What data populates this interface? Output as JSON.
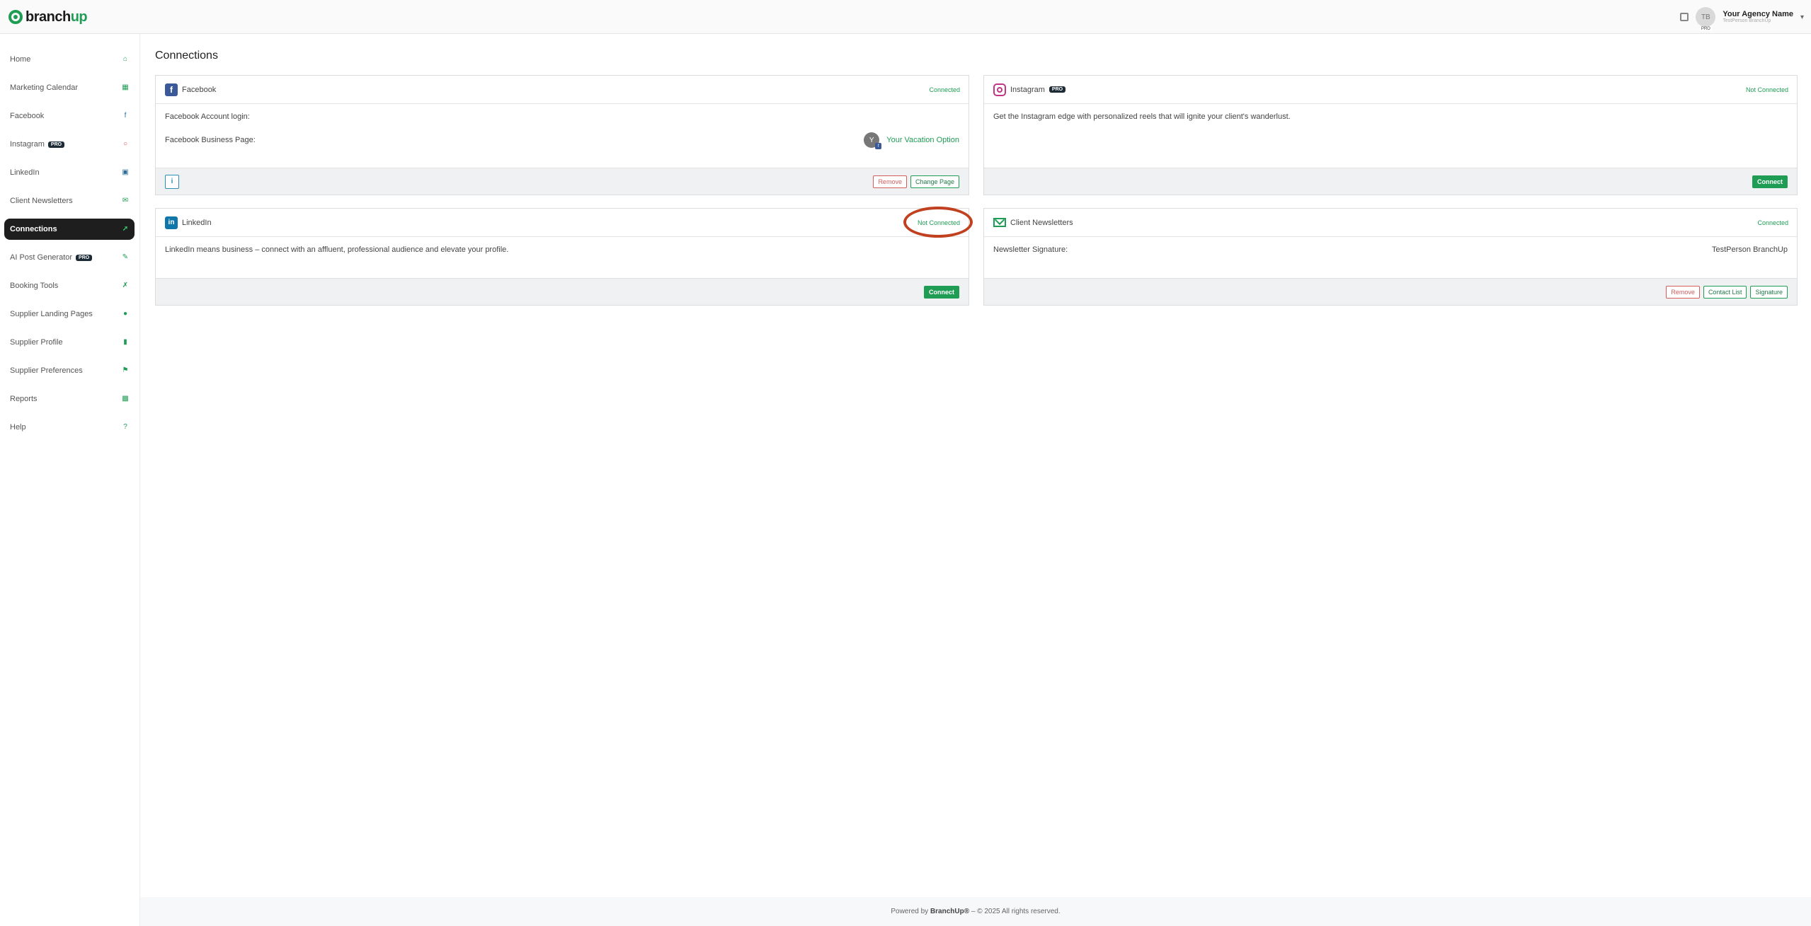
{
  "app": {
    "logo_part1": "branch",
    "logo_part2": "up"
  },
  "header": {
    "avatar_initials": "TB",
    "avatar_badge": "PRO",
    "agency_name": "Your Agency Name",
    "agency_sub": "TestPerson BranchUp"
  },
  "sidebar": {
    "items": [
      {
        "label": "Home",
        "icon": "home-icon"
      },
      {
        "label": "Marketing Calendar",
        "icon": "calendar-icon"
      },
      {
        "label": "Facebook",
        "icon": "facebook-icon"
      },
      {
        "label": "Instagram",
        "icon": "instagram-icon",
        "badge": "PRO"
      },
      {
        "label": "LinkedIn",
        "icon": "linkedin-icon"
      },
      {
        "label": "Client Newsletters",
        "icon": "envelope-icon"
      },
      {
        "label": "Connections",
        "icon": "plug-icon",
        "active": true
      },
      {
        "label": "AI Post Generator",
        "icon": "edit-icon",
        "badge": "PRO"
      },
      {
        "label": "Booking Tools",
        "icon": "wrench-icon"
      },
      {
        "label": "Supplier Landing Pages",
        "icon": "globe-icon"
      },
      {
        "label": "Supplier Profile",
        "icon": "book-icon"
      },
      {
        "label": "Supplier Preferences",
        "icon": "bookmark-icon"
      },
      {
        "label": "Reports",
        "icon": "chart-icon"
      },
      {
        "label": "Help",
        "icon": "question-icon"
      }
    ]
  },
  "main": {
    "title": "Connections",
    "facebook": {
      "title": "Facebook",
      "status": "Connected",
      "account_login_label": "Facebook Account login:",
      "business_page_label": "Facebook Business Page:",
      "page_avatar": "Y",
      "page_name": "Your Vacation Option",
      "remove_label": "Remove",
      "change_page_label": "Change Page"
    },
    "instagram": {
      "title": "Instagram",
      "badge": "PRO",
      "status": "Not Connected",
      "description": "Get the Instagram edge with personalized reels that will ignite your client's wanderlust.",
      "connect_label": "Connect"
    },
    "linkedin": {
      "title": "LinkedIn",
      "status": "Not Connected",
      "description": "LinkedIn means business – connect with an affluent, professional audience and elevate your profile.",
      "connect_label": "Connect"
    },
    "newsletters": {
      "title": "Client Newsletters",
      "status": "Connected",
      "signature_label": "Newsletter Signature:",
      "signature_value": "TestPerson BranchUp",
      "remove_label": "Remove",
      "contact_list_label": "Contact List",
      "signature_button_label": "Signature"
    }
  },
  "footer": {
    "prefix": "Powered by",
    "brand": "BranchUp®",
    "suffix": "– © 2025 All rights reserved."
  },
  "colors": {
    "accent": "#1f9d55",
    "danger": "#d35c5c",
    "sidebar_active": "#1e1e1e",
    "highlight_ring": "#c1401f"
  }
}
